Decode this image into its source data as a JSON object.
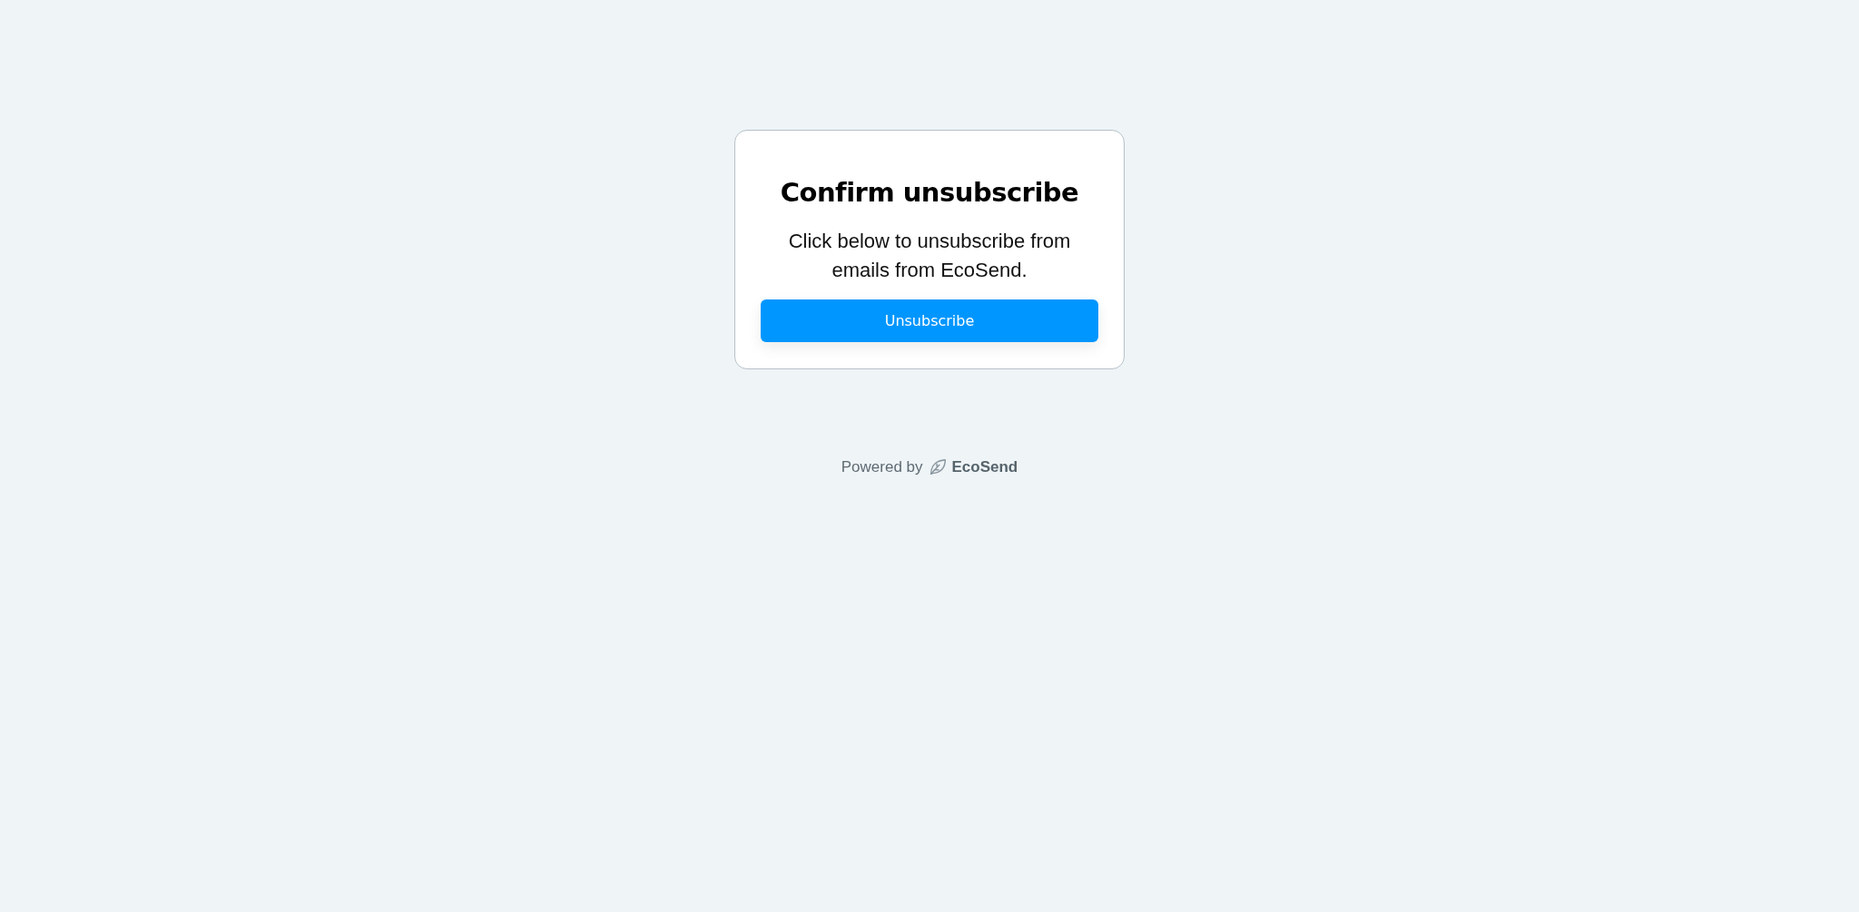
{
  "card": {
    "title": "Confirm unsubscribe",
    "message": "Click below to unsubscribe from emails from EcoSend.",
    "button": "Unsubscribe"
  },
  "footer": {
    "powered_by": "Powered by",
    "brand": "EcoSend"
  }
}
